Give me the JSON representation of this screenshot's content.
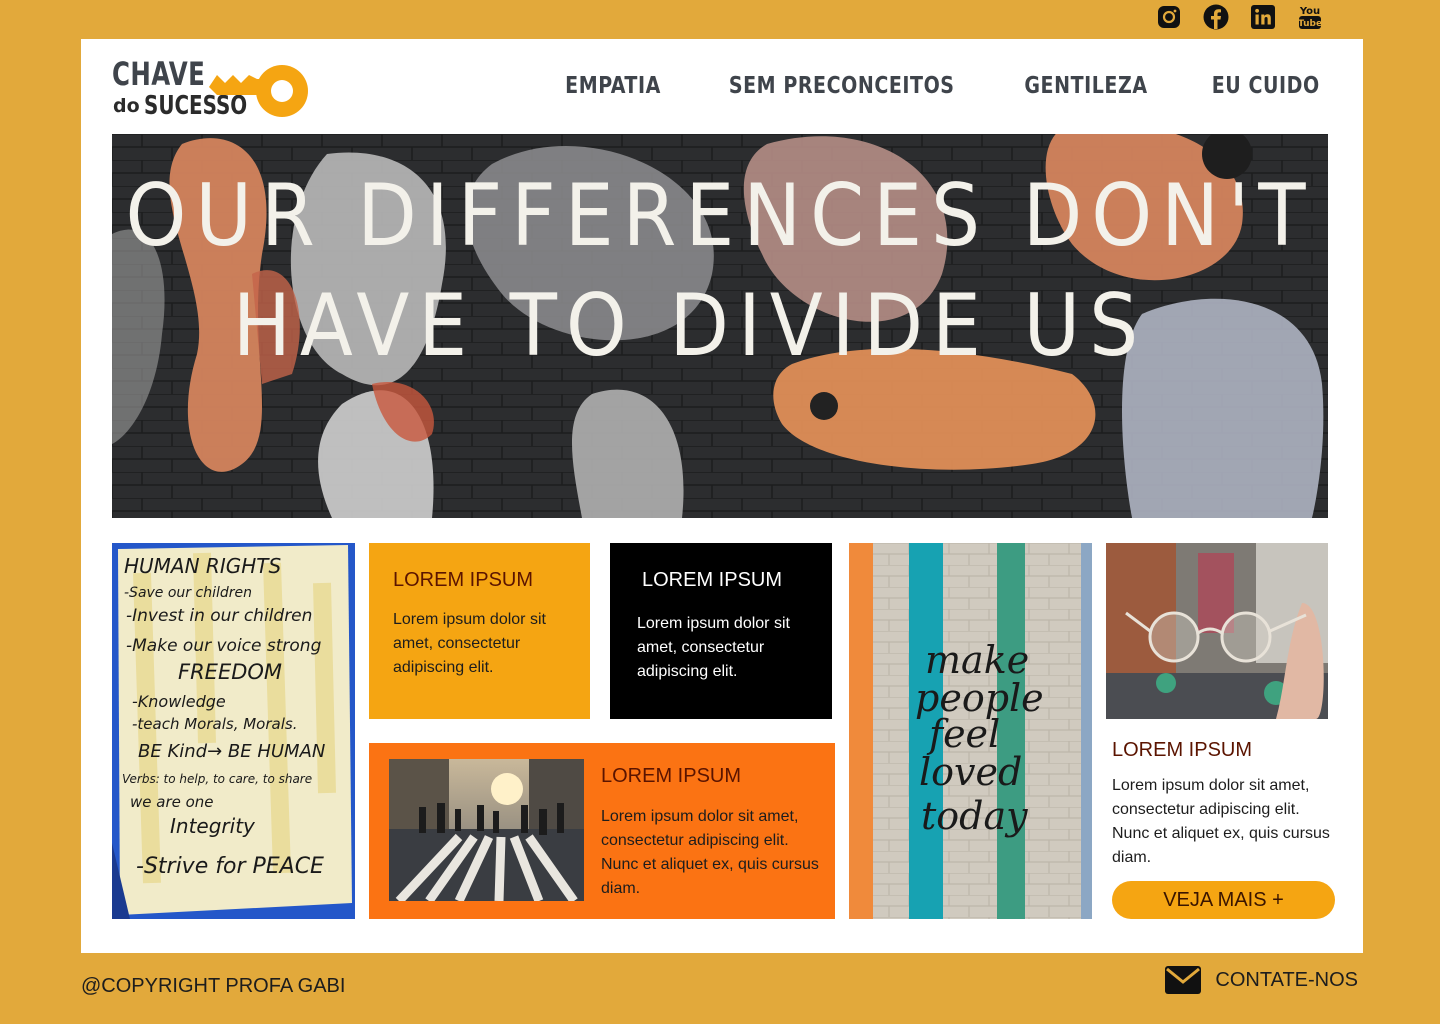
{
  "social": [
    {
      "icon": "instagram-icon"
    },
    {
      "icon": "facebook-icon"
    },
    {
      "icon": "linkedin-icon"
    },
    {
      "icon": "youtube-icon",
      "label_top": "You",
      "label_bottom": "Tube"
    }
  ],
  "logo": {
    "line1": "CHAVE",
    "line2_small": "do",
    "line2_big": "SUCESSO",
    "accent": "#F5A512"
  },
  "nav": {
    "items": [
      "EMPATIA",
      "SEM PRECONCEITOS",
      "GENTILEZA",
      "EU CUIDO"
    ]
  },
  "hero": {
    "line1": "OUR DIFFERENCES DON'T",
    "line2": "HAVE TO DIVIDE US"
  },
  "poster": {
    "lines": [
      "HUMAN RIGHTS",
      "-Save our children",
      "-Invest in our children",
      "-Make our voice strong",
      "FREEDOM",
      "-Knowledge",
      "-teach Morals, Morals.",
      "BE Kind→ BE HUMAN",
      "Verbs: to help, to care, to share",
      "we are one",
      "Integrity",
      "-Strive for PEACE"
    ]
  },
  "wall": {
    "lines": [
      "make",
      "people",
      "feel",
      "loved",
      "today"
    ]
  },
  "tiles": {
    "yellow": {
      "title": "LOREM IPSUM",
      "text": "Lorem ipsum dolor sit amet, consectetur adipiscing elit."
    },
    "black": {
      "title": "LOREM IPSUM",
      "text": "Lorem ipsum dolor sit amet, consectetur adipiscing elit."
    },
    "orange": {
      "title": "LOREM IPSUM",
      "text": "Lorem ipsum dolor sit amet, consectetur adipiscing elit. Nunc et aliquet ex, quis cursus diam."
    },
    "side": {
      "title": "LOREM IPSUM",
      "text": "Lorem ipsum dolor sit amet, consectetur adipiscing elit. Nunc et aliquet ex, quis cursus diam."
    }
  },
  "button": {
    "label": "VEJA MAIS +"
  },
  "footer": {
    "copyright": "@COPYRIGHT PROFA GABI",
    "contact": "CONTATE-NOS",
    "contact_icon": "mail-icon"
  },
  "colors": {
    "background": "#E2A93B",
    "yellow": "#F5A512",
    "orange": "#FB7313",
    "black": "#000000",
    "nav_text": "#3F444B"
  }
}
